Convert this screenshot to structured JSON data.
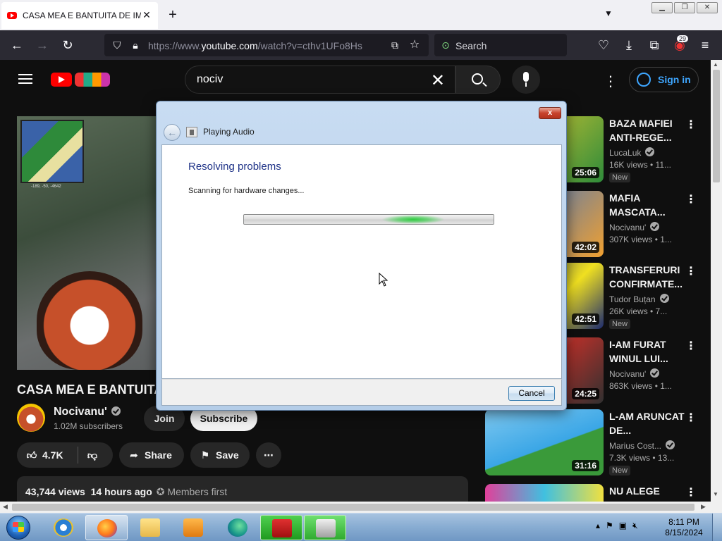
{
  "browser": {
    "tab_title": "CASA MEA E BANTUITA DE IMPO",
    "url_prefix": "https://www.",
    "url_domain": "youtube.com",
    "url_path": "/watch?v=cthv1UFo8Hs",
    "search_placeholder": "Search",
    "extensions_badge": "29"
  },
  "youtube": {
    "search_query": "nociv",
    "sign_in": "Sign in",
    "video": {
      "title": "CASA MEA E BANTUITA",
      "channel": "Nocivanu'",
      "subscribers": "1.02M subscribers",
      "join": "Join",
      "subscribe": "Subscribe",
      "likes": "4.7K",
      "share": "Share",
      "save": "Save",
      "views": "43,744 views",
      "age": "14 hours ago",
      "members_first": "Members first",
      "minimap_coords": "-189, -50, -4642"
    },
    "sidebar": [
      {
        "title": "BAZA MAFIEI ANTI-REGE...",
        "channel": "LucaLuk",
        "meta": "16K views • 11...",
        "duration": "25:06",
        "new": "New",
        "thumb": "#2e8b3a"
      },
      {
        "title": "MAFIA MASCATA...",
        "channel": "Nocivanu'",
        "meta": "307K views • 1...",
        "duration": "42:02",
        "new": "",
        "thumb": "#2a6fd6"
      },
      {
        "title": "TRANSFERURI CONFIRMATE...",
        "channel": "Tudor Buțan",
        "meta": "26K views • 7...",
        "duration": "42:51",
        "new": "New",
        "thumb": "#1c2a6e"
      },
      {
        "title": "I-AM FURAT WINUL LUI...",
        "channel": "Nocivanu'",
        "meta": "863K views • 1...",
        "duration": "24:25",
        "new": "",
        "thumb": "#b0302a"
      },
      {
        "title": "L-AM ARUNCAT DE...",
        "channel": "Marius Cost...",
        "meta": "7.3K views • 13...",
        "duration": "31:16",
        "new": "New",
        "thumb": "#3aa6e6"
      },
      {
        "title": "NU ALEGE",
        "channel": "",
        "meta": "",
        "duration": "",
        "new": "",
        "thumb": "#e0409a"
      }
    ]
  },
  "dialog": {
    "window_title": "Playing Audio",
    "heading": "Resolving problems",
    "status": "Scanning for hardware changes...",
    "cancel": "Cancel",
    "close": "x"
  },
  "taskbar": {
    "time": "8:11 PM",
    "date": "8/15/2024"
  },
  "colors": {
    "yt_bg": "#0f0f0f",
    "yt_link": "#3ea6ff",
    "dialog_heading": "#1e3287",
    "progress_glow": "#2ecc40"
  }
}
